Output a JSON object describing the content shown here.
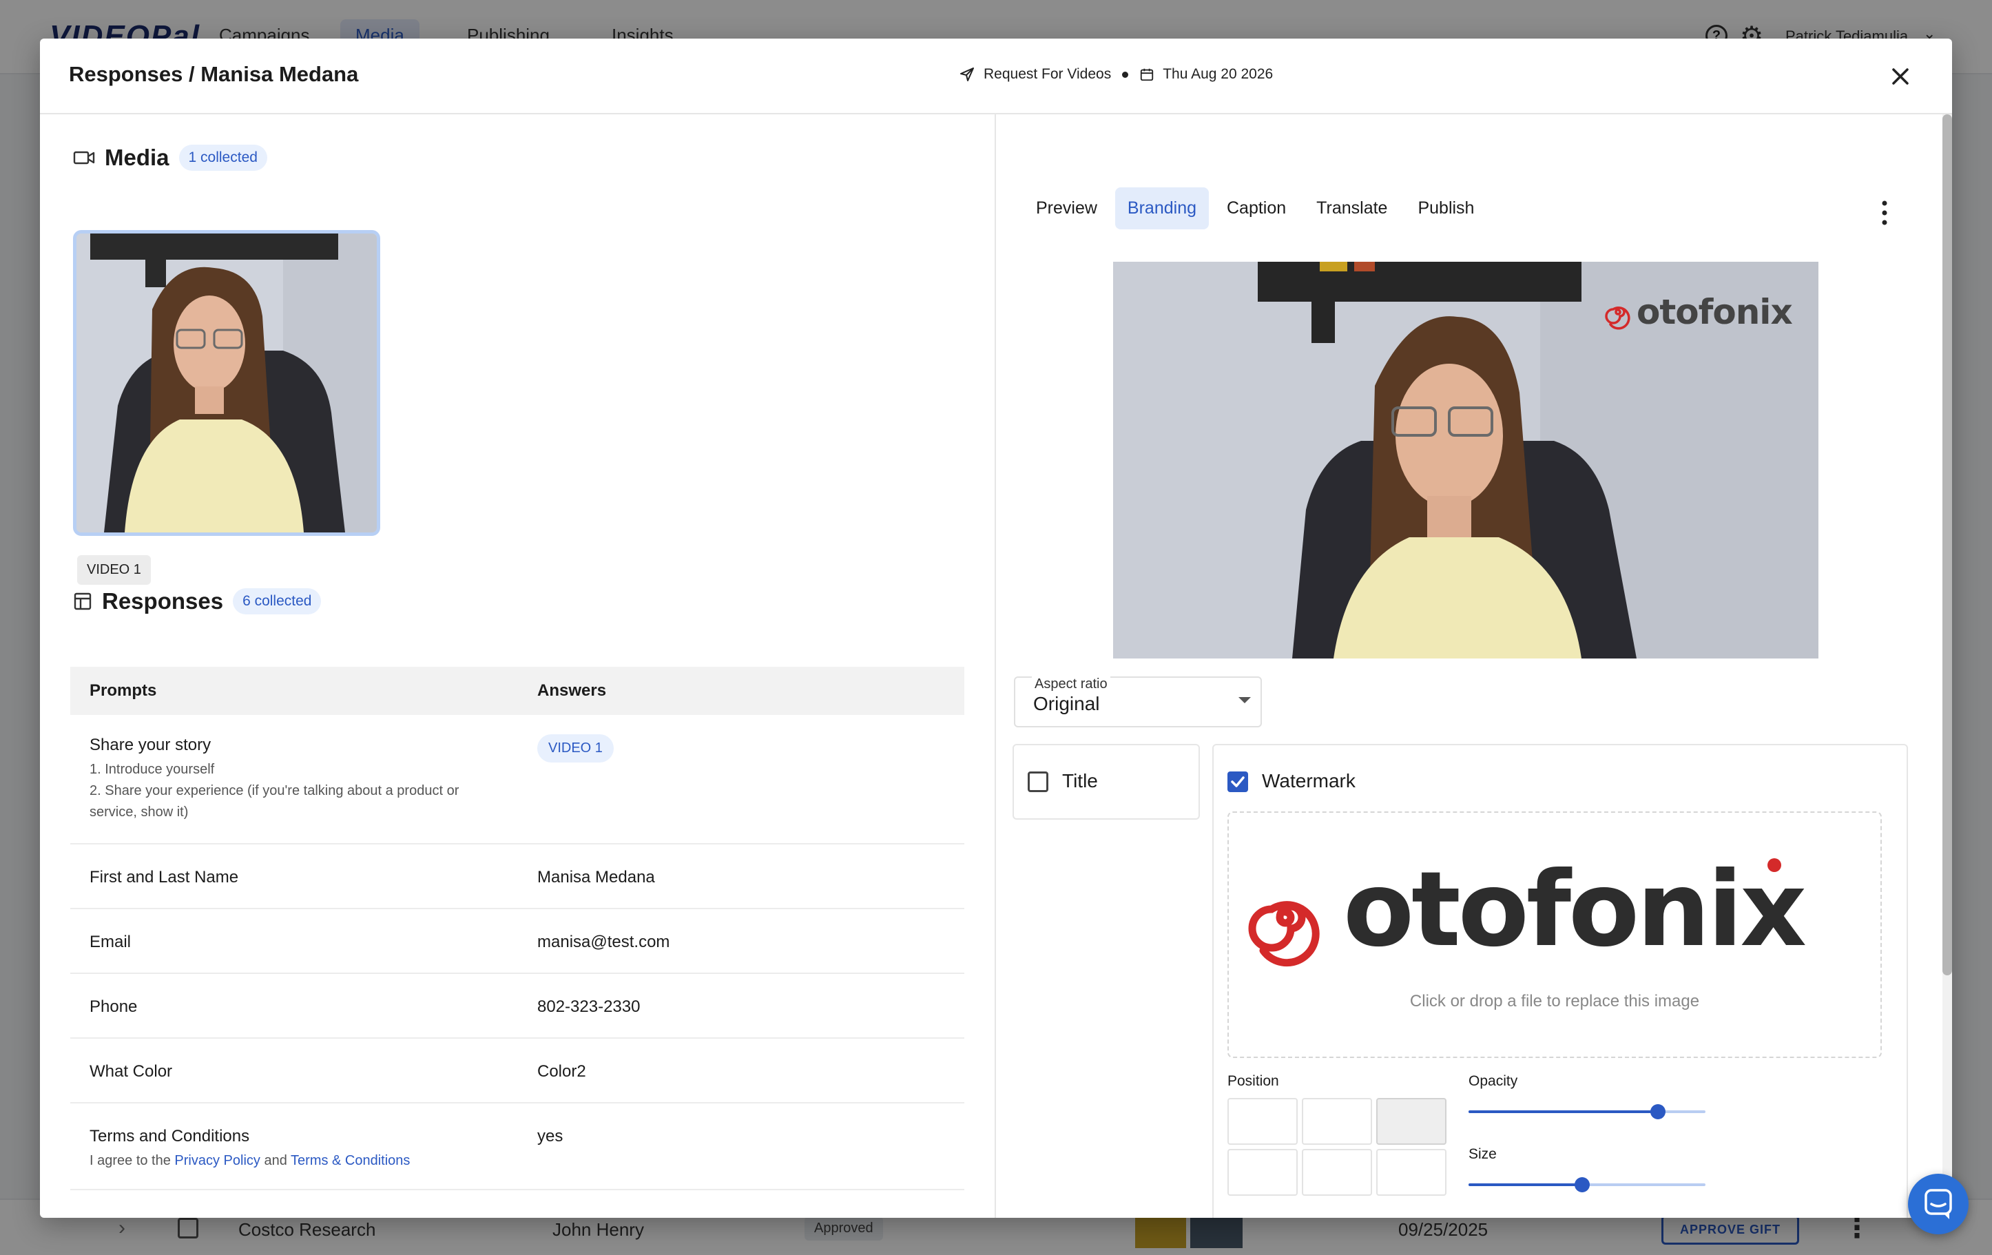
{
  "background": {
    "logo": "VIDEOPal",
    "nav": [
      "Campaigns",
      "Media",
      "Publishing",
      "Insights"
    ],
    "active_nav": "Media",
    "user_name": "Patrick Tedjamulia",
    "row": {
      "name": "Costco Research",
      "owner": "John Henry",
      "status": "Approved",
      "date": "09/25/2025",
      "action": "APPROVE GIFT"
    }
  },
  "modal": {
    "title": "Responses / Manisa Medana",
    "campaign": "Request For Videos",
    "date": "Thu Aug 20 2026"
  },
  "media": {
    "title": "Media",
    "count_label": "1 collected",
    "video_tag": "VIDEO 1"
  },
  "responses": {
    "title": "Responses",
    "count_label": "6 collected",
    "headers": [
      "Prompts",
      "Answers"
    ],
    "rows": [
      {
        "prompt": "Share your story",
        "sub_lines": [
          "1. Introduce yourself",
          "2. Share your experience (if you're talking about a product or",
          "service, show it)"
        ],
        "answer": "VIDEO 1"
      },
      {
        "prompt": "First and Last Name",
        "answer": "Manisa Medana"
      },
      {
        "prompt": "Email",
        "answer": "manisa@test.com"
      },
      {
        "prompt": "Phone",
        "answer": "802-323-2330"
      },
      {
        "prompt": "What Color",
        "answer": "Color2"
      },
      {
        "prompt": "Terms and Conditions",
        "terms_prefix": "I agree to the ",
        "privacy_link": "Privacy Policy",
        "terms_and": " and ",
        "terms_link": "Terms & Conditions",
        "answer": "yes"
      }
    ]
  },
  "editor": {
    "tabs": [
      "Preview",
      "Branding",
      "Caption",
      "Translate",
      "Publish"
    ],
    "active_tab": "Branding",
    "aspect_ratio": {
      "label": "Aspect ratio",
      "value": "Original"
    },
    "title_option": {
      "label": "Title",
      "checked": false
    },
    "watermark": {
      "label": "Watermark",
      "checked": true,
      "logo_text": "otofonix",
      "drop_hint": "Click or drop a file to replace this image",
      "position_label": "Position",
      "selected_position": "top-right",
      "opacity_label": "Opacity",
      "opacity_value": 0.8,
      "size_label": "Size",
      "size_value": 0.48
    }
  },
  "colors": {
    "accent": "#2b59c3",
    "pill_bg": "#e8f0fd",
    "logo_red": "#d42a2a"
  }
}
